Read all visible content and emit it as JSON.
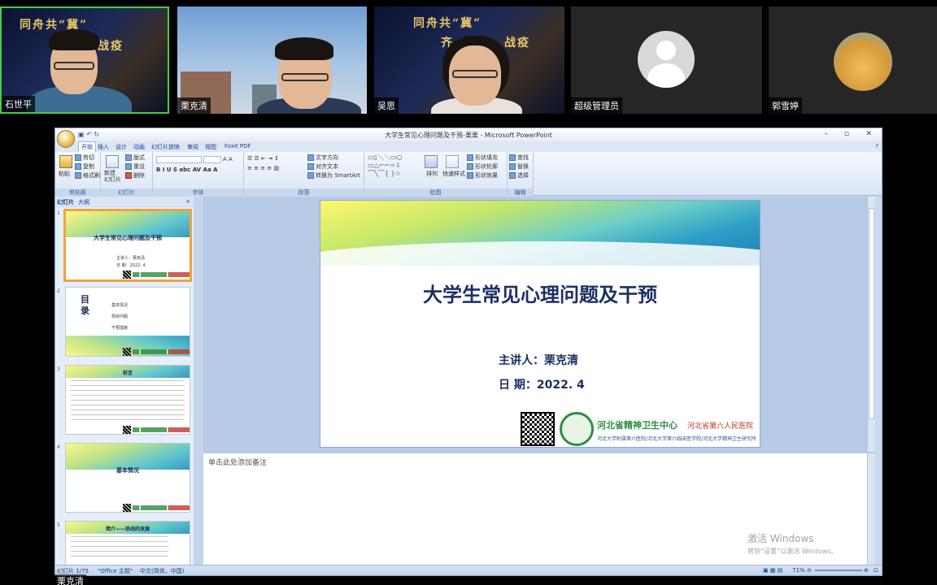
{
  "meeting": {
    "participants": [
      {
        "name": "石世平",
        "banner_text": [
          "同舟共“冀”",
          "战疫"
        ]
      },
      {
        "name": "栗克清"
      },
      {
        "name": "吴思",
        "banner_text": [
          "同舟共“冀”",
          "齐",
          "战疫"
        ]
      },
      {
        "name": "超级管理员"
      },
      {
        "name": "郭雪婷"
      }
    ],
    "active_speaker": "栗克清"
  },
  "app": {
    "window_title": "大学生常见心理问题及干预-栗栗 - Microsoft PowerPoint",
    "ribbon_tabs": [
      "开始",
      "插入",
      "设计",
      "动画",
      "幻灯片放映",
      "审阅",
      "视图",
      "Foxit PDF"
    ],
    "active_tab": "开始",
    "groups": {
      "clipboard": {
        "label": "剪贴板",
        "paste": "粘贴",
        "cut": "剪切",
        "copy": "复制",
        "format_painter": "格式刷"
      },
      "slides": {
        "label": "幻灯片",
        "new_slide": "新建\n幻灯片",
        "layout": "版式",
        "reset": "重设",
        "delete": "删除"
      },
      "font": {
        "label": "字体"
      },
      "paragraph": {
        "label": "段落",
        "text_direction": "文字方向",
        "align_text": "对齐文本",
        "smartart": "转换为 SmartArt"
      },
      "drawing": {
        "label": "绘图",
        "arrange": "排列",
        "quick_styles": "快速样式",
        "shape_fill": "形状填充",
        "shape_outline": "形状轮廓",
        "shape_effects": "形状效果"
      },
      "editing": {
        "label": "编辑",
        "find": "查找",
        "replace": "替换",
        "select": "选择"
      }
    },
    "panel_tabs": [
      "幻灯片",
      "大纲"
    ],
    "thumbnails": [
      {
        "num": "1",
        "title": "大学生常见心理问题及干预",
        "lines": [
          "主讲人：栗克清",
          "日  期：2022. 4"
        ]
      },
      {
        "num": "2",
        "title": "目\n录",
        "lines": [
          "基本情况",
          "现状问题",
          "干预措施"
        ]
      },
      {
        "num": "3",
        "title": "前言"
      },
      {
        "num": "4",
        "title": "基本情况"
      },
      {
        "num": "5",
        "title": "简介——热线的发展"
      }
    ],
    "slide": {
      "title": "大学生常见心理问题及干预",
      "presenter_label": "主讲人：栗克清",
      "date_label": "日   期：2022. 4",
      "hospital_name": "河北省精神卫生中心",
      "hospital_name2": "河北省第六人民医院",
      "hospital_sub": "河北大学附属第六医院/河北大学第六临床医学院/河北大学精神卫生研究所"
    },
    "notes_placeholder": "单击此处添加备注",
    "watermark": {
      "line1": "激活 Windows",
      "line2": "转到“设置”以激活 Windows。"
    },
    "status": {
      "slide_counter": "幻灯片 1/75",
      "theme": "\"Office 主题\"",
      "language": "中文(简体，中国)",
      "zoom": "71%"
    }
  }
}
